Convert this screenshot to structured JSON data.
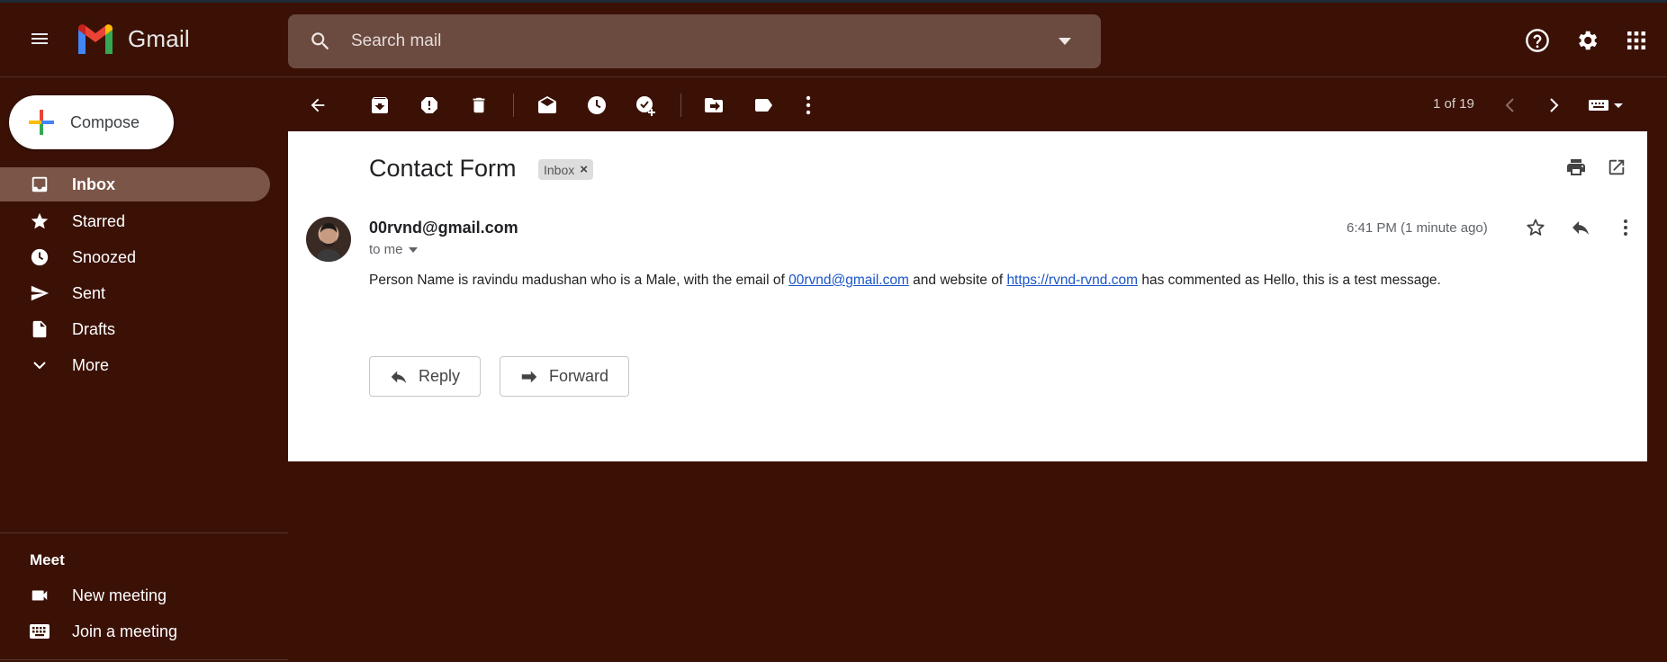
{
  "app": {
    "title": "Gmail"
  },
  "search": {
    "placeholder": "Search mail"
  },
  "compose": {
    "label": "Compose"
  },
  "sidebar": {
    "items": [
      {
        "label": "Inbox",
        "icon": "inbox-icon",
        "active": true
      },
      {
        "label": "Starred",
        "icon": "star-icon"
      },
      {
        "label": "Snoozed",
        "icon": "clock-icon"
      },
      {
        "label": "Sent",
        "icon": "send-icon"
      },
      {
        "label": "Drafts",
        "icon": "draft-icon"
      },
      {
        "label": "More",
        "icon": "chevron-down-icon"
      }
    ]
  },
  "meet": {
    "title": "Meet",
    "items": [
      {
        "label": "New meeting",
        "icon": "video-icon"
      },
      {
        "label": "Join a meeting",
        "icon": "keyboard-icon"
      }
    ]
  },
  "toolbar": {
    "pager": "1 of 19"
  },
  "message": {
    "subject": "Contact Form",
    "label": "Inbox",
    "sender": "00rvnd@gmail.com",
    "to": "to me",
    "time": "6:41 PM (1 minute ago)",
    "body_pre": "Person Name is ravindu madushan who is a Male, with the email of ",
    "email_link": "00rvnd@gmail.com",
    "body_mid": " and website of ",
    "website_link": "https://rvnd-rvnd.com",
    "body_post": " has commented as Hello, this is a test message."
  },
  "actions": {
    "reply": "Reply",
    "forward": "Forward"
  },
  "colors": {
    "background": "#3b1106",
    "active_nav": "#7a5548",
    "search_bg": "#6b4a40",
    "link": "#1a55c8"
  }
}
